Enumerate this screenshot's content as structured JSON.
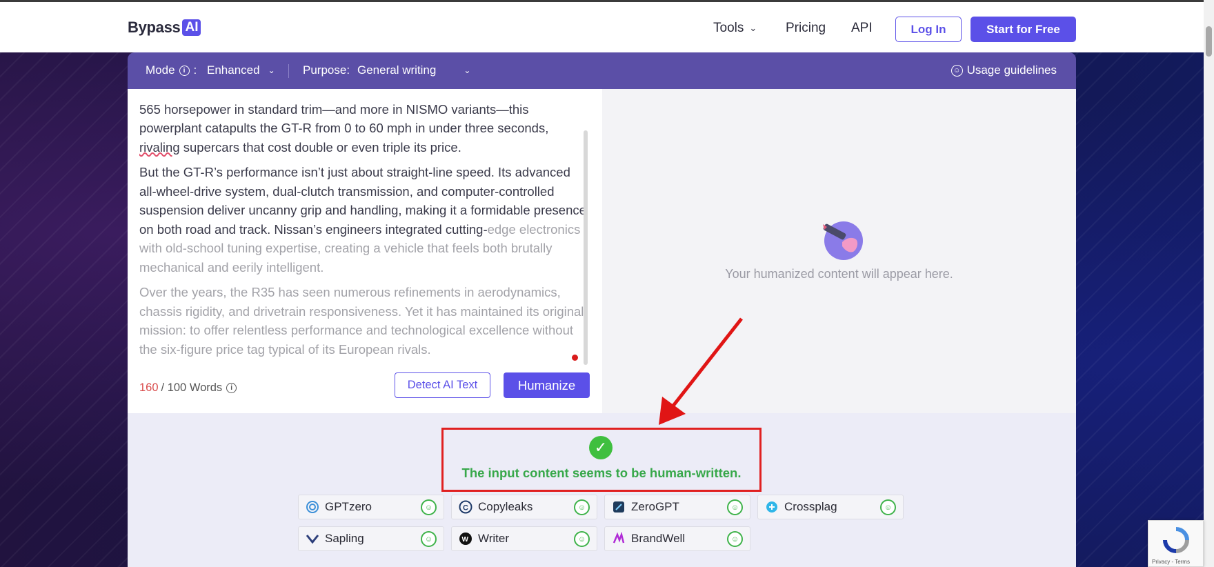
{
  "header": {
    "logo_text": "Bypass",
    "logo_badge": "AI",
    "nav": {
      "tools": "Tools",
      "pricing": "Pricing",
      "api": "API"
    },
    "login_label": "Log In",
    "start_label": "Start for Free"
  },
  "modebar": {
    "mode_label": "Mode",
    "mode_value": "Enhanced",
    "purpose_label": "Purpose:",
    "purpose_value": "General writing",
    "usage_label": "Usage guidelines"
  },
  "editor": {
    "p1_line1": "565 horsepower in standard trim—and more in NISMO variants—this",
    "p1_line2": "powerplant catapults the GT-R from 0 to 60 mph in under three seconds,",
    "p1_word": "rivaling",
    "p1_rest": " supercars that cost double or even triple its price.",
    "p2_main": "But the GT-R’s performance isn’t just about straight-line speed. Its advanced all-wheel-drive system, dual-clutch transmission, and computer-controlled suspension deliver uncanny grip and handling, making it a formidable presence on both road and track. Nissan’s engineers integrated cutting-",
    "p2_faded": "edge electronics with old-school tuning expertise, creating a vehicle that feels both brutally mechanical and eerily intelligent.",
    "p3": "Over the years, the R35 has seen numerous refinements in aerodynamics, chassis rigidity, and drivetrain responsiveness. Yet it has maintained its original mission: to offer relentless performance and technological excellence without the six-figure price tag typical of its European rivals.",
    "words_used": "160",
    "words_limit": "/ 100 Words",
    "detect_label": "Detect AI Text",
    "humanize_label": "Humanize"
  },
  "output": {
    "placeholder": "Your humanized content will appear here."
  },
  "results": {
    "message": "The input content seems to be human-written.",
    "detectors": [
      {
        "name": "GPTzero",
        "icon": "gptzero-icon"
      },
      {
        "name": "Copyleaks",
        "icon": "copyleaks-icon"
      },
      {
        "name": "ZeroGPT",
        "icon": "zerogpt-icon"
      },
      {
        "name": "Crossplag",
        "icon": "crossplag-icon"
      },
      {
        "name": "Sapling",
        "icon": "sapling-icon"
      },
      {
        "name": "Writer",
        "icon": "writer-icon"
      },
      {
        "name": "BrandWell",
        "icon": "brandwell-icon"
      }
    ]
  },
  "recaptcha": {
    "links": "Privacy - Terms"
  },
  "colors": {
    "accent": "#5b50e8",
    "modebar": "#5b4fa7",
    "success": "#3fbf3f",
    "highlight": "#e02020"
  }
}
